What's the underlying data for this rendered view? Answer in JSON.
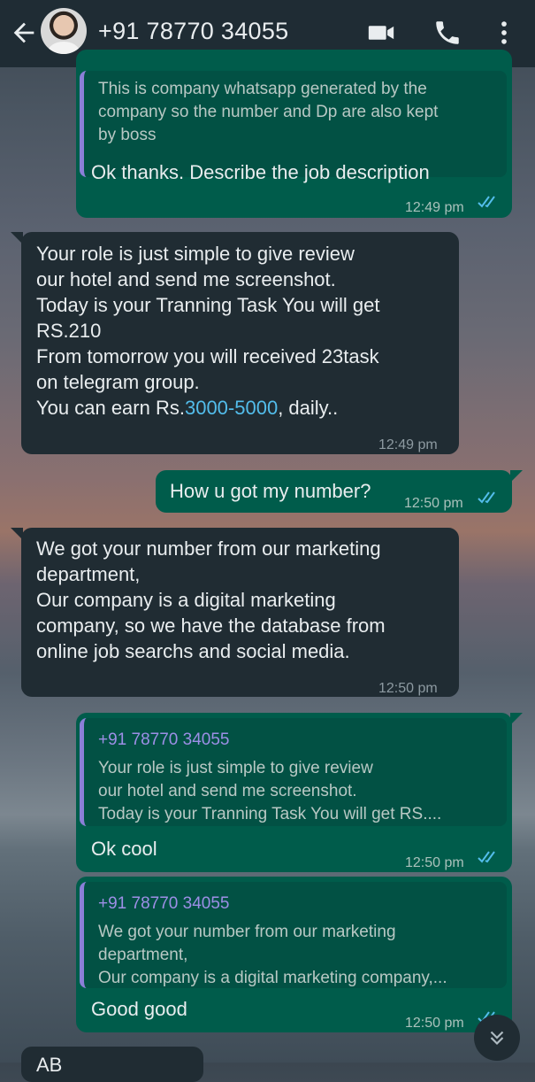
{
  "header": {
    "contact_name": "+91 78770 34055",
    "icons": [
      "back-arrow-icon",
      "avatar",
      "video-call-icon",
      "phone-icon",
      "more-vertical-icon"
    ]
  },
  "messages": [
    {
      "direction": "outgoing",
      "quote_text": "This is company whatsapp generated by the\ncompany so the number and Dp are also kept\nby boss",
      "text": "Ok thanks. Describe the job description",
      "time": "12:49 pm",
      "status": "read"
    },
    {
      "direction": "incoming",
      "text_before_link": "Your role is just simple to give review\nour hotel and send me screenshot.\nToday is your  Tranning Task You will get\nRS.210\nFrom tomorrow you will received 23task\non telegram group.\nYou can earn  Rs.",
      "link": "3000-5000",
      "text_after_link": ", daily..",
      "time": "12:49 pm"
    },
    {
      "direction": "outgoing",
      "text": "How u got my number?",
      "time": "12:50 pm",
      "status": "read"
    },
    {
      "direction": "incoming",
      "text": "We got your number from our marketing\ndepartment,\nOur company is a digital marketing\ncompany, so we have the database from\nonline job searchs and social media.",
      "time": "12:50 pm"
    },
    {
      "direction": "outgoing",
      "quote_sender": "+91 78770 34055",
      "quote_text": "Your role is just simple to give review\nour hotel and send me screenshot.\nToday is your  Tranning Task You will get  RS....",
      "text": "Ok cool",
      "time": "12:50 pm",
      "status": "read"
    },
    {
      "direction": "outgoing",
      "quote_sender": "+91 78770 34055",
      "quote_text": "We got your number from our marketing\ndepartment,\nOur company is a digital marketing company,...",
      "text": "Good good",
      "time": "12:50 pm",
      "status": "read"
    }
  ],
  "partial_message": {
    "text": "AB"
  },
  "colors": {
    "header_bg": "#1f2c34",
    "outgoing_bubble": "#005c4b",
    "incoming_bubble": "#202c33",
    "read_ticks": "#53bdeb",
    "link": "#53bdeb",
    "quote_sender": "#9d8fe6"
  }
}
